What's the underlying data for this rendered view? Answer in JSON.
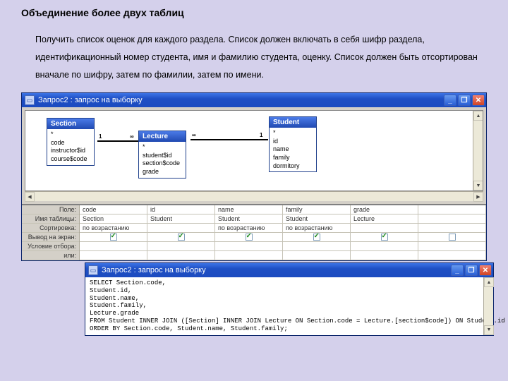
{
  "heading": "Объединение более двух таблиц",
  "description": "Получить список оценок для каждого раздела. Список должен включать в себя шифр раздела, идентификационный номер студента, имя и фамилию студента, оценку. Список должен быть отсортирован вначале по шифру, затем по фамилии, затем по имени.",
  "window1": {
    "title": "Запрос2 : запрос на выборку",
    "tables": {
      "section": {
        "title": "Section",
        "fields": [
          "*",
          "code",
          "instructor$id",
          "course$code"
        ]
      },
      "lecture": {
        "title": "Lecture",
        "fields": [
          "*",
          "student$id",
          "section$code",
          "grade"
        ]
      },
      "student": {
        "title": "Student",
        "fields": [
          "*",
          "id",
          "name",
          "family",
          "dormitory"
        ]
      }
    },
    "joinLabels": {
      "one": "1",
      "many": "∞"
    },
    "grid": {
      "rowLabels": [
        "Поле:",
        "Имя таблицы:",
        "Сортировка:",
        "Вывод на экран:",
        "Условие отбора:",
        "или:"
      ],
      "columns": [
        {
          "field": "code",
          "table": "Section",
          "sort": "по возрастанию",
          "show": true
        },
        {
          "field": "id",
          "table": "Student",
          "sort": "",
          "show": true
        },
        {
          "field": "name",
          "table": "Student",
          "sort": "по возрастанию",
          "show": true
        },
        {
          "field": "family",
          "table": "Student",
          "sort": "по возрастанию",
          "show": true
        },
        {
          "field": "grade",
          "table": "Lecture",
          "sort": "",
          "show": true
        },
        {
          "field": "",
          "table": "",
          "sort": "",
          "show": false
        }
      ]
    }
  },
  "window2": {
    "title": "Запрос2 : запрос на выборку",
    "sql": [
      "SELECT Section.code,",
      "Student.id,",
      "Student.name,",
      "Student.family,",
      "Lecture.grade",
      "FROM Student INNER JOIN ([Section] INNER JOIN Lecture ON Section.code = Lecture.[section$code]) ON Student.id = Lecture.[student$id]",
      "ORDER BY Section.code, Student.name, Student.family;"
    ]
  },
  "winControls": {
    "min": "_",
    "max": "❐",
    "close": "✕"
  },
  "scrollArrows": {
    "up": "▲",
    "down": "▼",
    "left": "◀",
    "right": "▶"
  }
}
